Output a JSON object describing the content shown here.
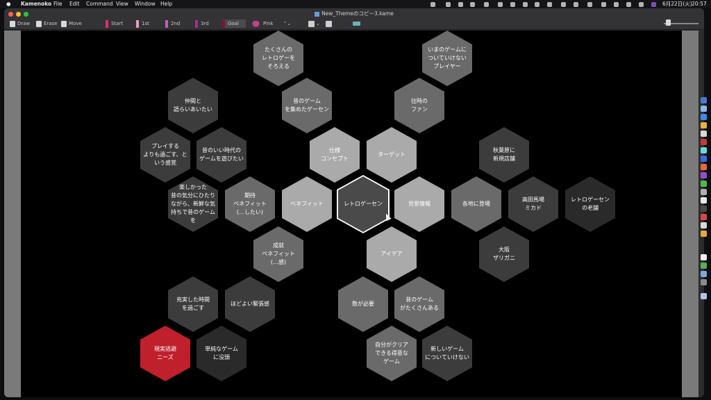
{
  "menubar": {
    "items": [
      "Kamenoko",
      "File",
      "Edit",
      "Command",
      "View",
      "Window",
      "Help"
    ],
    "date": "6月22日(火)",
    "time": "20:57"
  },
  "window": {
    "title": "New_Themeのコピー3.kame"
  },
  "toolbar": {
    "draw": "Draw",
    "erase": "Erase",
    "move": "Move",
    "start": "Start",
    "first": "1st",
    "second": "2nd",
    "third": "3rd",
    "goal": "Goal",
    "color_select": "Pink",
    "color_select_arrow": "⌃⌄",
    "share_arrow": "⌄"
  },
  "colors": {
    "start": "#e8287a",
    "first": "#e4a0c8",
    "second": "#c060b0",
    "third": "#a03088",
    "goal": "#80103c",
    "pink_dot": "#c0408c",
    "light_gray": "#aaaaaa",
    "mid_gray": "#6a6a6a",
    "dark_gray": "#3c3c3c",
    "darker_gray": "#2a2a2a",
    "red": "#c0202c"
  },
  "hexes": [
    {
      "label": "たくさんの\nレトロゲーを\nそろえる",
      "tone": "mid"
    },
    {
      "label": "いまのゲームに\nついていけない\nプレイヤー",
      "tone": "mid"
    },
    {
      "label": "仲間と\n語らいあいたい",
      "tone": "dark"
    },
    {
      "label": "昔のゲーム\nを集めたゲーセン",
      "tone": "mid"
    },
    {
      "label": "往時の\nファン",
      "tone": "mid"
    },
    {
      "label": "プレイする\nよりも過ごす、と\nいう感覚",
      "tone": "dark"
    },
    {
      "label": "昔のいい時代の\nゲームを遊びたい",
      "tone": "dark"
    },
    {
      "label": "仕様\nコンセプト",
      "tone": "light"
    },
    {
      "label": "ターゲット",
      "tone": "light"
    },
    {
      "label": "秋葉原に\n新規店舗",
      "tone": "dark"
    },
    {
      "label": "楽しかった\n昔の気分にひたり\nながら、新鮮な気\n持ちで昔のゲーム\nを",
      "tone": "dark"
    },
    {
      "label": "期待\nベネフィット\n(…したい)",
      "tone": "mid"
    },
    {
      "label": "ベネフィット",
      "tone": "light"
    },
    {
      "label": "レトロゲーセン",
      "tone": "center"
    },
    {
      "label": "背景情報",
      "tone": "light"
    },
    {
      "label": "各地に登場",
      "tone": "mid"
    },
    {
      "label": "高田馬場\nミカド",
      "tone": "dark"
    },
    {
      "label": "レトロゲーセン\nの老舗",
      "tone": "darker"
    },
    {
      "label": "成就\nベネフィット\n(…感)",
      "tone": "mid"
    },
    {
      "label": "アイデア",
      "tone": "light"
    },
    {
      "label": "大阪\nザリガニ",
      "tone": "dark"
    },
    {
      "label": "充実した時間\nを過ごす",
      "tone": "dark"
    },
    {
      "label": "ほどよい緊張感",
      "tone": "dark"
    },
    {
      "label": "数が必要",
      "tone": "mid"
    },
    {
      "label": "昔のゲーム\nがたくさんある",
      "tone": "mid"
    },
    {
      "label": "現実逃避\nニーズ",
      "tone": "red"
    },
    {
      "label": "単純なゲーム\nに没頭",
      "tone": "darker"
    },
    {
      "label": "自分がクリア\nできる得意な\nゲーム",
      "tone": "mid"
    },
    {
      "label": "新しいゲーム\nについていけない",
      "tone": "dark"
    }
  ]
}
